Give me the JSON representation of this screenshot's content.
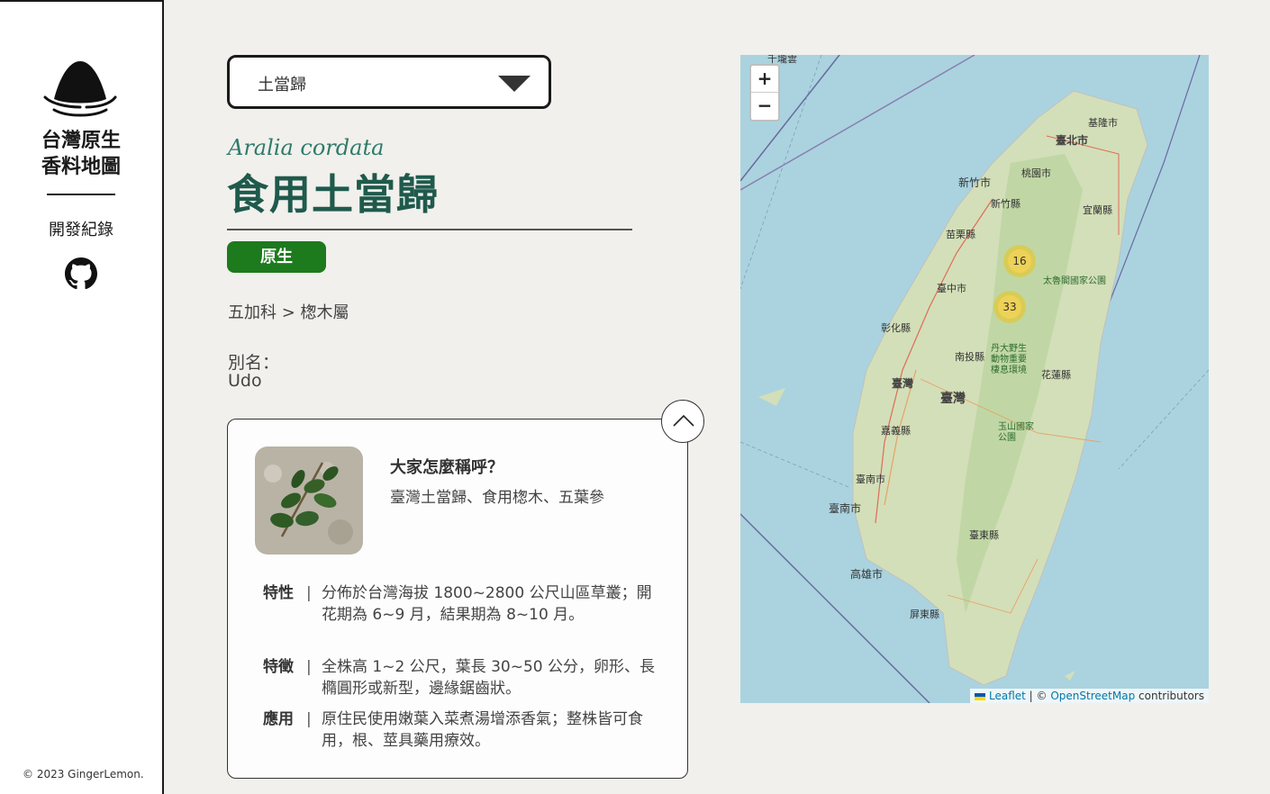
{
  "sidebar": {
    "brand_line1": "台灣原生",
    "brand_line2": "香料地圖",
    "devlog": "開發紀錄",
    "copyright": "© 2023 GingerLemon."
  },
  "select": {
    "value": "土當歸"
  },
  "plant": {
    "scientific_name": "Aralia cordata",
    "common_name": "食用土當歸",
    "badge": "原生",
    "taxonomy": "五加科 > 楤木屬",
    "alias_label": "別名：",
    "alias_value": "Udo"
  },
  "card": {
    "question": "大家怎麼稱呼？",
    "answer": "臺灣土當歸、食用楤木、五葉參",
    "rows": [
      {
        "label": "特性",
        "sep": "|",
        "text": "分佈於台灣海拔 1800~2800 公尺山區草叢；開花期為 6~9 月，結果期為 8~10 月。"
      },
      {
        "label": "特徵",
        "sep": "|",
        "text": "全株高 1~2 公尺，葉長 30~50 公分，卵形、長橢圓形或新型，邊緣鋸齒狀。"
      },
      {
        "label": "應用",
        "sep": "|",
        "text": "原住民使用嫩葉入菜煮湯增添香氣；整株皆可食用，根、莖具藥用療效。"
      }
    ]
  },
  "map": {
    "zoom_in": "+",
    "zoom_out": "−",
    "clusters": [
      {
        "count": "16"
      },
      {
        "count": "33"
      }
    ],
    "labels": {
      "keelung": "基隆市",
      "taipei": "臺北市",
      "taoyuan": "桃園市",
      "hsinchu_city": "新竹市",
      "hsinchu_county": "新竹縣",
      "yilan": "宜蘭縣",
      "miaoli": "苗栗縣",
      "taichung": "臺中市",
      "changhua": "彰化縣",
      "nantou": "南投縣",
      "yunlin": "臺灣",
      "taiwan": "臺灣",
      "chiayi": "嘉義縣",
      "tainan": "臺南市",
      "tainan_city": "臺南市",
      "kaohsiung": "高雄市",
      "pingtung": "屏東縣",
      "taitung": "臺東縣",
      "hualien": "花蓮縣",
      "taroko": "太魯閣國家公園",
      "yushan": "玉山國家公園",
      "danda": "丹大野生動物重要棲息環境",
      "top": "千壠雲"
    },
    "attribution": {
      "leaflet": "Leaflet",
      "sep": " | © ",
      "osm": "OpenStreetMap",
      "contributors": " contributors"
    }
  },
  "colors": {
    "accent_green": "#1d7a1d",
    "title_green": "#1f5a4c",
    "sci_name_teal": "#2f7a6c",
    "map_water": "#aad3df"
  }
}
